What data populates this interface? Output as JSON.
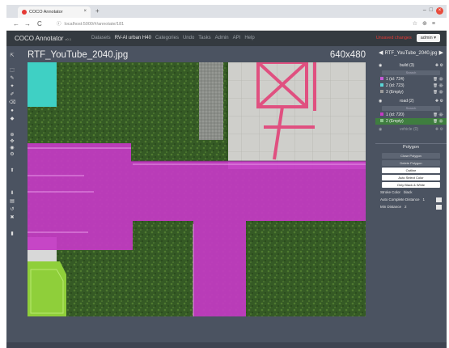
{
  "browser": {
    "tab_title": "COCO Annotator",
    "tab_close": "×",
    "new_tab": "+",
    "nav_back": "←",
    "nav_forward": "→",
    "nav_reload": "C",
    "url": "localhost:5000/#/annotate/181",
    "window_close": "×"
  },
  "app": {
    "brand": "COCO Annotator",
    "version": "v0.1",
    "nav_links": [
      "Datasets",
      "RV-AI urban H40",
      "Categories",
      "Undo",
      "Tasks",
      "Admin",
      "API",
      "Help"
    ],
    "active_nav_index": 1,
    "status_text": "Unsaved changes",
    "user_button": "admin ▾"
  },
  "canvas": {
    "image_name": "RTF_YouTube_2040.jpg",
    "image_size": "640x480"
  },
  "panel": {
    "filename": "RTF_YouTube_2040.jpg",
    "prev": "◀",
    "next": "▶",
    "categories": [
      {
        "name": "build (3)",
        "search": "Search",
        "annotations": [
          {
            "label": "1 (id: 724)",
            "color": "#c45bd6"
          },
          {
            "label": "2 (id: 723)",
            "color": "#5bd6d6"
          },
          {
            "label": "3 (Empty)",
            "color": "#9a9a9a"
          }
        ]
      },
      {
        "name": "road (2)",
        "search": "Search",
        "annotations": [
          {
            "label": "1 (id: 720)",
            "color": "#c43ac4"
          },
          {
            "label": "2 (Empty)",
            "color": "#8ac48a"
          }
        ]
      },
      {
        "name": "vehicle (0)",
        "search": "",
        "annotations": []
      }
    ],
    "polygon_title": "Polygon",
    "buttons": [
      "Close Polygon",
      "Delete Polygon",
      "Outline",
      "Auto Select Color",
      "Only Black & White"
    ],
    "settings": [
      {
        "label": "Stroke Color",
        "value": "black"
      },
      {
        "label": "Auto Complete Distance",
        "value": "1"
      },
      {
        "label": "Min Distance",
        "value": "2"
      }
    ],
    "icons": {
      "eye": "eye-icon",
      "plus": "plus-icon",
      "gear": "gear-icon"
    }
  },
  "colors": {
    "road_overlay": "#c43ac4",
    "build_overlay": "#3fd0c4",
    "build_green": "#8fcf3a",
    "structure_pink": "#e05080"
  }
}
